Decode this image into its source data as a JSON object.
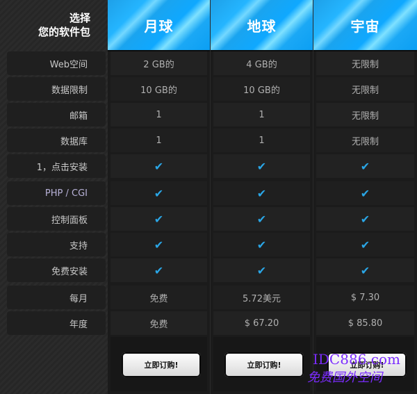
{
  "header": {
    "title_line1": "选择",
    "title_line2": "您的软件包",
    "plans": [
      "月球",
      "地球",
      "宇宙"
    ]
  },
  "rows": [
    {
      "label": "Web空间",
      "values": [
        "2 GB的",
        "4 GB的",
        "无限制"
      ]
    },
    {
      "label": "数据限制",
      "values": [
        "10 GB的",
        "10 GB的",
        "无限制"
      ]
    },
    {
      "label": "邮箱",
      "values": [
        "1",
        "1",
        "无限制"
      ]
    },
    {
      "label": "数据库",
      "values": [
        "1",
        "1",
        "无限制"
      ]
    },
    {
      "label": "1，点击安装",
      "values": [
        "✔",
        "✔",
        "✔"
      ]
    },
    {
      "label": "PHP / CGI",
      "values": [
        "✔",
        "✔",
        "✔"
      ]
    },
    {
      "label": "控制面板",
      "values": [
        "✔",
        "✔",
        "✔"
      ]
    },
    {
      "label": "支持",
      "values": [
        "✔",
        "✔",
        "✔"
      ]
    },
    {
      "label": "免费安装",
      "values": [
        "✔",
        "✔",
        "✔"
      ]
    },
    {
      "label": "每月",
      "values": [
        "免费",
        "5.72美元",
        "$ 7.30"
      ]
    },
    {
      "label": "年度",
      "values": [
        "免费",
        "$ 67.20",
        "$ 85.80"
      ]
    }
  ],
  "footer": {
    "button_label": "立即订购!",
    "watermark_line1": "IDC886.com",
    "watermark_line2": "免费国外空间"
  }
}
